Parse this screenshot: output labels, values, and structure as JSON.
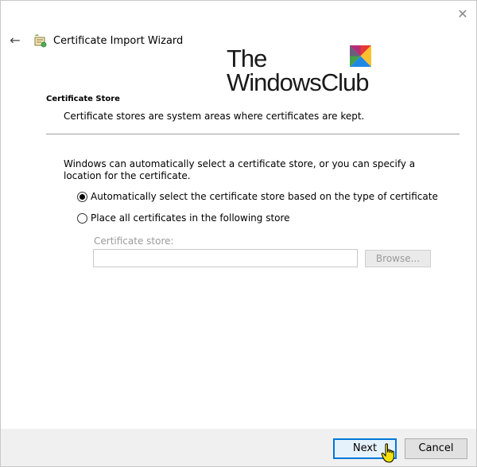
{
  "window": {
    "close_glyph": "✕"
  },
  "header": {
    "back_glyph": "←",
    "wizard_title": "Certificate Import Wizard",
    "wizard_icon": "certificate-icon"
  },
  "watermark": {
    "line1": "The",
    "line2": "WindowsClub"
  },
  "section": {
    "title": "Certificate Store",
    "description": "Certificate stores are system areas where certificates are kept."
  },
  "body": {
    "intro": "Windows can automatically select a certificate store, or you can specify a location for the certificate.",
    "options": [
      {
        "label": "Automatically select the certificate store based on the type of certificate",
        "checked": true
      },
      {
        "label": "Place all certificates in the following store",
        "checked": false
      }
    ],
    "store_label": "Certificate store:",
    "store_value": "",
    "browse_label": "Browse..."
  },
  "footer": {
    "next_label": "Next",
    "cancel_label": "Cancel"
  },
  "colors": {
    "accent": "#0078d7",
    "footer_bg": "#f0f0f0",
    "disabled_text": "#9a9a9a"
  }
}
